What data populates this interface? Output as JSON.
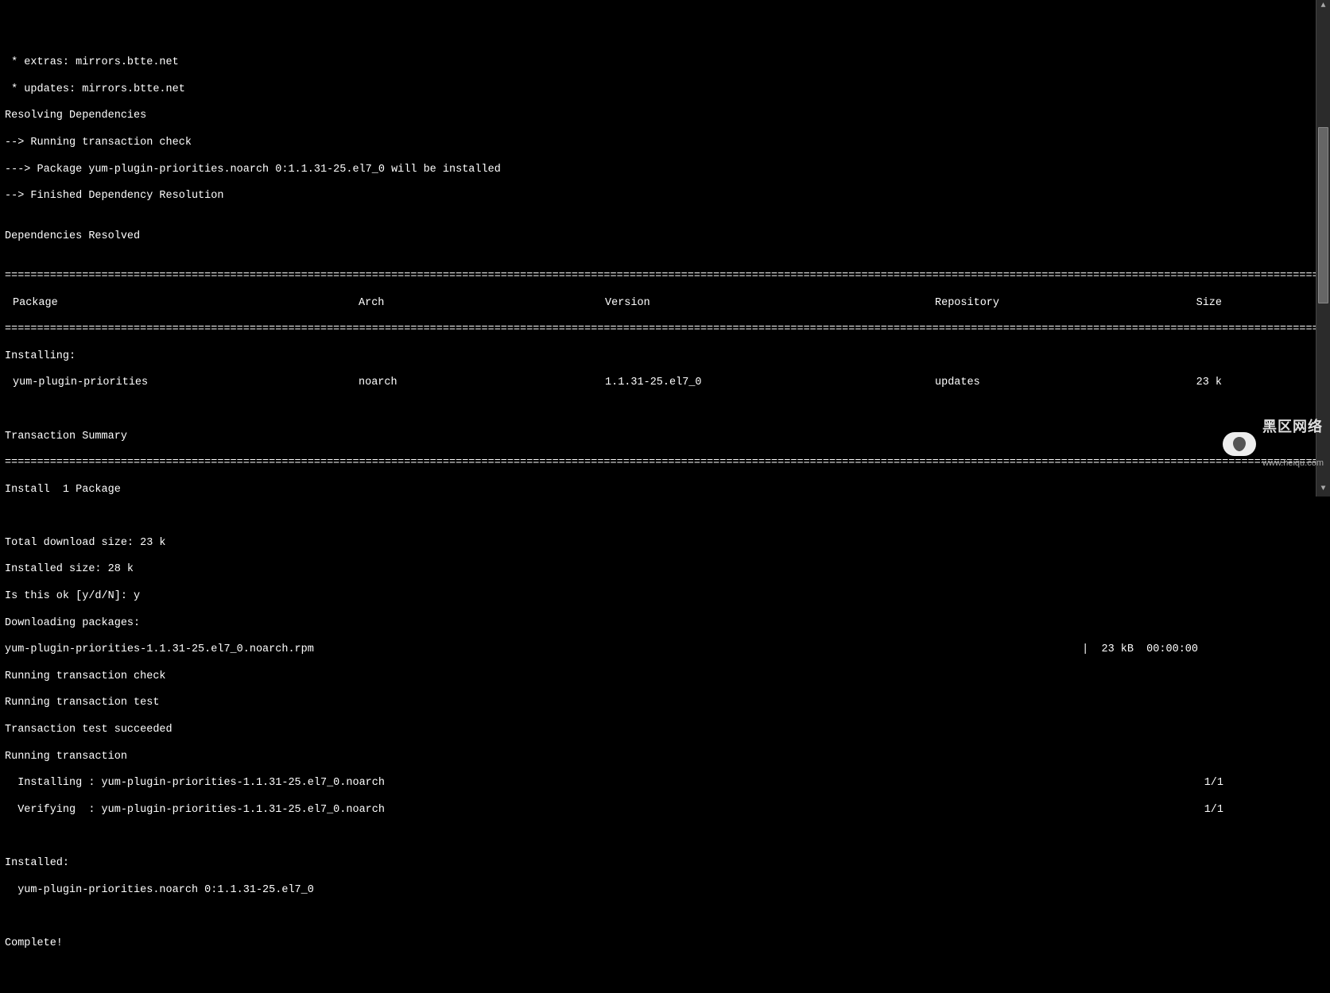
{
  "header_lines": [
    " * extras: mirrors.btte.net",
    " * updates: mirrors.btte.net",
    "Resolving Dependencies",
    "--> Running transaction check",
    "---> Package yum-plugin-priorities.noarch 0:1.1.31-25.el7_0 will be installed",
    "--> Finished Dependency Resolution",
    "",
    "Dependencies Resolved",
    ""
  ],
  "table": {
    "headers": {
      "package": "Package",
      "arch": "Arch",
      "version": "Version",
      "repository": "Repository",
      "size": "Size"
    },
    "installing_label": "Installing:",
    "rows": [
      {
        "package": "yum-plugin-priorities",
        "arch": "noarch",
        "version": "1.1.31-25.el7_0",
        "repository": "updates",
        "size": "23 k"
      }
    ],
    "summary_label": "Transaction Summary",
    "install_count": "Install  1 Package"
  },
  "post": {
    "total_download": "Total download size: 23 k",
    "installed_size": "Installed size: 28 k",
    "prompt": "Is this ok [y/d/N]: y",
    "downloading": "Downloading packages:",
    "rpm_name": "yum-plugin-priorities-1.1.31-25.el7_0.noarch.rpm",
    "rpm_stats": "|  23 kB  00:00:00",
    "run_check": "Running transaction check",
    "run_test": "Running transaction test",
    "test_ok": "Transaction test succeeded",
    "run_trans": "Running transaction",
    "installing_line": "  Installing : yum-plugin-priorities-1.1.31-25.el7_0.noarch",
    "installing_prog": "1/1",
    "verifying_line": "  Verifying  : yum-plugin-priorities-1.1.31-25.el7_0.noarch",
    "verifying_prog": "1/1",
    "installed_label": "Installed:",
    "installed_pkg": "  yum-plugin-priorities.noarch 0:1.1.31-25.el7_0",
    "complete": "Complete!"
  },
  "watermark": {
    "top": "黑区网络",
    "bottom": "www.heiqu.com"
  }
}
